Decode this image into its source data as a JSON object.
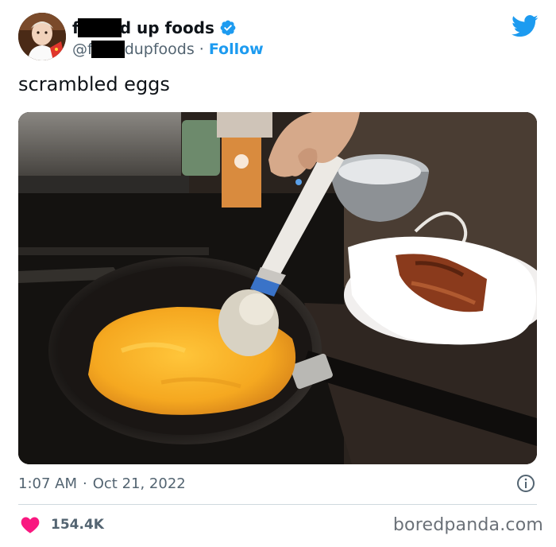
{
  "tweet": {
    "display_name_start": "f",
    "display_name_end": "d up foods",
    "handle_start": "@f",
    "handle_end": "dupfoods",
    "separator": "·",
    "follow_label": "Follow",
    "text": "scrambled eggs",
    "time": "1:07 AM",
    "date": "Oct 21, 2022",
    "likes": "154.4K"
  },
  "watermark": "boredpanda.com",
  "colors": {
    "accent": "#1d9bf0",
    "like": "#f91880",
    "secondary_text": "#536471"
  },
  "icons": {
    "verified": "verified-badge-icon",
    "brand": "twitter-bird-icon",
    "info": "info-icon",
    "like": "heart-icon"
  }
}
